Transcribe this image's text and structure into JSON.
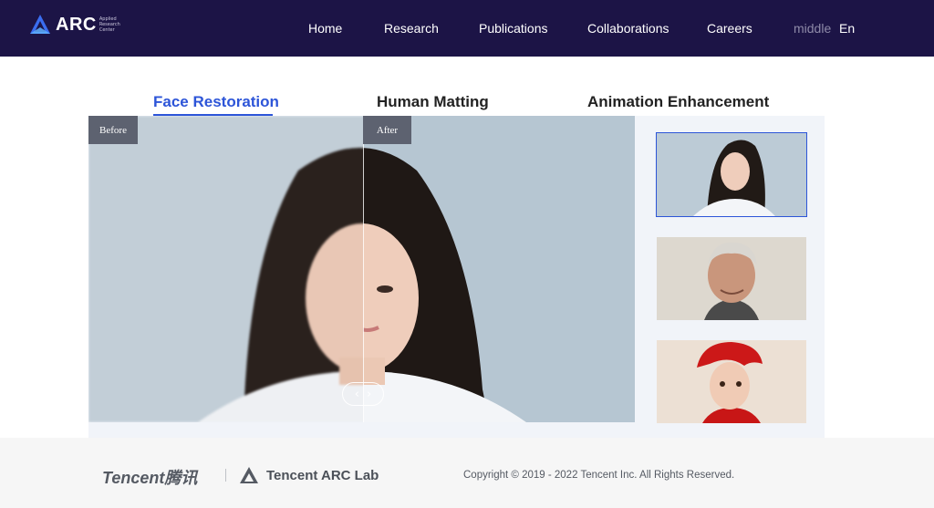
{
  "header": {
    "logo_text": "ARC",
    "logo_sub": "Applied Research Center",
    "nav": [
      {
        "label": "Home"
      },
      {
        "label": "Research"
      },
      {
        "label": "Publications"
      },
      {
        "label": "Collaborations"
      },
      {
        "label": "Careers"
      }
    ],
    "lang_current": "middle",
    "lang_alt": "En"
  },
  "tabs": [
    {
      "label": "Face Restoration",
      "active": true
    },
    {
      "label": "Human Matting",
      "active": false
    },
    {
      "label": "Animation Enhancement",
      "active": false
    }
  ],
  "compare": {
    "before_label": "Before",
    "after_label": "After",
    "handle_left": "‹",
    "handle_right": "›"
  },
  "thumbnails": [
    {
      "selected": true
    },
    {
      "selected": false
    },
    {
      "selected": false
    }
  ],
  "footer": {
    "tencent_logo": "Tencent腾讯",
    "arc_lab": "Tencent ARC Lab",
    "copyright": "Copyright © 2019 - 2022 Tencent Inc. All Rights Reserved."
  },
  "colors": {
    "header_bg": "#1c1446",
    "accent": "#2d55d8",
    "footer_bg": "#f6f6f6"
  }
}
